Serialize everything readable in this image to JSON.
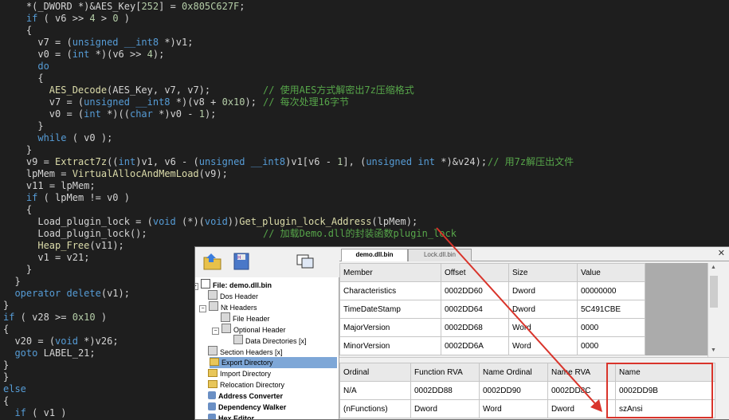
{
  "code_lines": [
    "    *(_DWORD *)&AES_Key[252] = 0x805C627F;",
    "    if ( v6 >> 4 > 0 )",
    "    {",
    "      v7 = (unsigned __int8 *)v1;",
    "      v0 = (int *)(v6 >> 4);",
    "      do",
    "      {",
    "        AES_Decode(AES_Key, v7, v7);",
    "        v7 = (unsigned __int8 *)(v8 + 0x10);",
    "        v0 = (int *)((char *)v0 - 1);",
    "      }",
    "      while ( v0 );",
    "    }",
    "    v9 = Extract7z((int)v1, v6 - (unsigned __int8)v1[v6 - 1], (unsigned int *)&v24);",
    "    lpMem = VirtualAllocAndMemLoad(v9);",
    "    v11 = lpMem;",
    "    if ( lpMem != v0 )",
    "    {",
    "      Load_plugin_lock = (void (*)(void))Get_plugin_lock_Address(lpMem);",
    "      Load_plugin_lock();",
    "      Heap_Free(v11);",
    "      v1 = v21;",
    "    }",
    "  }",
    "  operator delete(v1);",
    "}",
    "if ( v28 >= 0x10 )",
    "{",
    "  v20 = (void *)v26;",
    "  goto LABEL_21;",
    "}",
    "}",
    "else",
    "{",
    "  if ( v1 )"
  ],
  "comments": {
    "aes": "// 使用AES方式解密出7z压缩格式",
    "chunk": "// 每次处理16字节",
    "extract": "// 用7z解压出文件",
    "load": "// 加载Demo.dll的封装函数plugin_lock"
  },
  "cff": {
    "tabs": [
      "demo.dll.bin",
      "Lock.dll.bin"
    ],
    "close": "✕",
    "tree": [
      {
        "label": "File: demo.dll.bin",
        "bold": true
      },
      {
        "label": "Dos Header"
      },
      {
        "label": "Nt Headers"
      },
      {
        "label": "File Header"
      },
      {
        "label": "Optional Header"
      },
      {
        "label": "Data Directories [x]"
      },
      {
        "label": "Section Headers [x]"
      },
      {
        "label": "Export Directory",
        "selected": true
      },
      {
        "label": "Import Directory"
      },
      {
        "label": "Relocation Directory"
      },
      {
        "label": "Address Converter",
        "bold": true
      },
      {
        "label": "Dependency Walker",
        "bold": true
      },
      {
        "label": "Hex Editor",
        "bold": true
      }
    ],
    "upper_table": {
      "headers": [
        "Member",
        "Offset",
        "Size",
        "Value"
      ],
      "rows": [
        [
          "Characteristics",
          "0002DD60",
          "Dword",
          "00000000"
        ],
        [
          "TimeDateStamp",
          "0002DD64",
          "Dword",
          "5C491CBE"
        ],
        [
          "MajorVersion",
          "0002DD68",
          "Word",
          "0000"
        ],
        [
          "MinorVersion",
          "0002DD6A",
          "Word",
          "0000"
        ]
      ]
    },
    "lower_table": {
      "headers": [
        "Ordinal",
        "Function RVA",
        "Name Ordinal",
        "Name RVA",
        "Name"
      ],
      "rows": [
        [
          "N/A",
          "0002DD88",
          "0002DD90",
          "0002DD8C",
          "0002DD9B"
        ],
        [
          "(nFunctions)",
          "Dword",
          "Word",
          "Dword",
          "szAnsi"
        ]
      ]
    }
  },
  "colors": {
    "editor_bg": "#1e1e1e",
    "annotation_red": "#d9342b"
  }
}
